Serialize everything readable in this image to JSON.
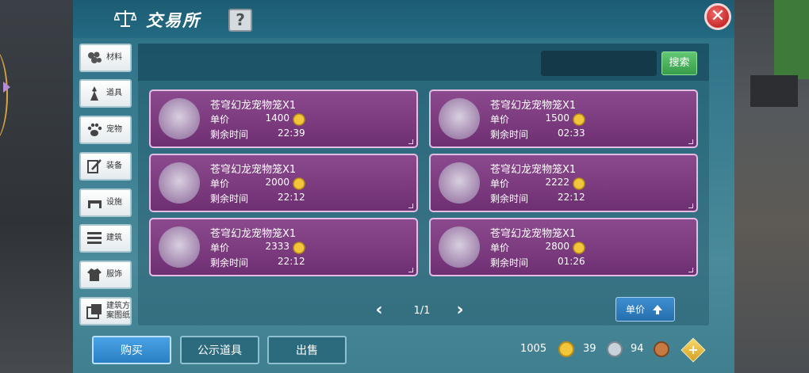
{
  "window": {
    "title": "交易所",
    "help_label": "?",
    "close_label": "✕"
  },
  "sidebar": {
    "items": [
      {
        "label": "材料",
        "icon": "materials-icon"
      },
      {
        "label": "道具",
        "icon": "items-icon"
      },
      {
        "label": "宠物",
        "icon": "pet-paw-icon"
      },
      {
        "label": "装备",
        "icon": "equipment-icon"
      },
      {
        "label": "设施",
        "icon": "facility-icon"
      },
      {
        "label": "建筑",
        "icon": "building-icon"
      },
      {
        "label": "服饰",
        "icon": "clothing-icon"
      },
      {
        "label": "建筑方案图纸",
        "icon": "blueprint-icon"
      }
    ]
  },
  "search": {
    "value": "",
    "placeholder": "",
    "button_label": "搜索"
  },
  "listing": {
    "price_label": "单价",
    "time_label": "剩余时间",
    "items": [
      {
        "name": "苍穹幻龙宠物笼X1",
        "price": "1400",
        "time": "22:39"
      },
      {
        "name": "苍穹幻龙宠物笼X1",
        "price": "1500",
        "time": "02:33"
      },
      {
        "name": "苍穹幻龙宠物笼X1",
        "price": "2000",
        "time": "22:12"
      },
      {
        "name": "苍穹幻龙宠物笼X1",
        "price": "2222",
        "time": "22:12"
      },
      {
        "name": "苍穹幻龙宠物笼X1",
        "price": "2333",
        "time": "22:12"
      },
      {
        "name": "苍穹幻龙宠物笼X1",
        "price": "2800",
        "time": "01:26"
      }
    ]
  },
  "pagination": {
    "text": "1/1",
    "prev_label": "‹",
    "next_label": "›"
  },
  "sort": {
    "label": "单价"
  },
  "tabs": {
    "buy": "购买",
    "public": "公示道具",
    "sell": "出售"
  },
  "currency": {
    "gold": "1005",
    "silver": "39",
    "bronze": "94",
    "add_label": "+"
  },
  "colors": {
    "panel": "#3d7f92",
    "card": "#7a3a7e",
    "search_button": "#46ae58",
    "buy_tab": "#3a93d8",
    "close_button": "#d93a3a"
  }
}
